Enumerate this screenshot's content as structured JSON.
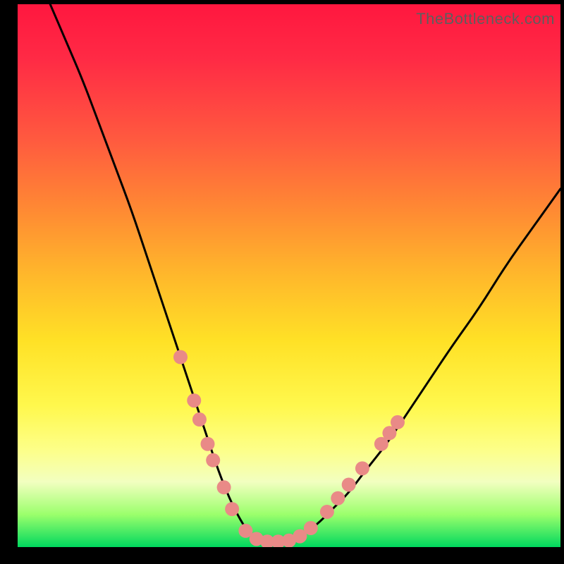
{
  "watermark": "TheBottleneck.com",
  "chart_data": {
    "type": "line",
    "title": "",
    "xlabel": "",
    "ylabel": "",
    "xlim": [
      0,
      100
    ],
    "ylim": [
      0,
      100
    ],
    "background_gradient": {
      "orientation": "vertical",
      "stops": [
        {
          "pct": 0,
          "color": "#ff173f"
        },
        {
          "pct": 10,
          "color": "#ff2a45"
        },
        {
          "pct": 25,
          "color": "#ff5a3f"
        },
        {
          "pct": 38,
          "color": "#ff8a33"
        },
        {
          "pct": 50,
          "color": "#ffb82b"
        },
        {
          "pct": 62,
          "color": "#ffe126"
        },
        {
          "pct": 74,
          "color": "#fff84d"
        },
        {
          "pct": 82,
          "color": "#fdff88"
        },
        {
          "pct": 88,
          "color": "#f2ffc0"
        },
        {
          "pct": 94,
          "color": "#9bff6c"
        },
        {
          "pct": 100,
          "color": "#00d85e"
        }
      ]
    },
    "series": [
      {
        "name": "left-curve",
        "color": "#000000",
        "x": [
          6,
          9,
          12,
          15,
          18,
          21,
          24,
          27,
          29,
          31,
          33,
          35,
          37,
          39,
          41,
          43
        ],
        "y": [
          100,
          93,
          86,
          78,
          70,
          62,
          53,
          44,
          38,
          32,
          26,
          20,
          14,
          9,
          5,
          2
        ]
      },
      {
        "name": "right-curve",
        "color": "#000000",
        "x": [
          52,
          55,
          58,
          61,
          64,
          68,
          72,
          76,
          80,
          85,
          90,
          95,
          100
        ],
        "y": [
          2,
          4,
          7,
          10,
          14,
          19,
          25,
          31,
          37,
          44,
          52,
          59,
          66
        ]
      },
      {
        "name": "valley-floor",
        "color": "#000000",
        "x": [
          43,
          46,
          49,
          52
        ],
        "y": [
          2,
          1,
          1,
          2
        ]
      }
    ],
    "markers": [
      {
        "x": 30.0,
        "y": 35.0
      },
      {
        "x": 32.5,
        "y": 27.0
      },
      {
        "x": 33.5,
        "y": 23.5
      },
      {
        "x": 35.0,
        "y": 19.0
      },
      {
        "x": 36.0,
        "y": 16.0
      },
      {
        "x": 38.0,
        "y": 11.0
      },
      {
        "x": 39.5,
        "y": 7.0
      },
      {
        "x": 42.0,
        "y": 3.0
      },
      {
        "x": 44.0,
        "y": 1.5
      },
      {
        "x": 46.0,
        "y": 1.0
      },
      {
        "x": 48.0,
        "y": 1.0
      },
      {
        "x": 50.0,
        "y": 1.2
      },
      {
        "x": 52.0,
        "y": 2.0
      },
      {
        "x": 54.0,
        "y": 3.5
      },
      {
        "x": 57.0,
        "y": 6.5
      },
      {
        "x": 59.0,
        "y": 9.0
      },
      {
        "x": 61.0,
        "y": 11.5
      },
      {
        "x": 63.5,
        "y": 14.5
      },
      {
        "x": 67.0,
        "y": 19.0
      },
      {
        "x": 68.5,
        "y": 21.0
      },
      {
        "x": 70.0,
        "y": 23.0
      }
    ],
    "marker_style": {
      "color": "#e98a87",
      "radius_px": 10
    }
  }
}
